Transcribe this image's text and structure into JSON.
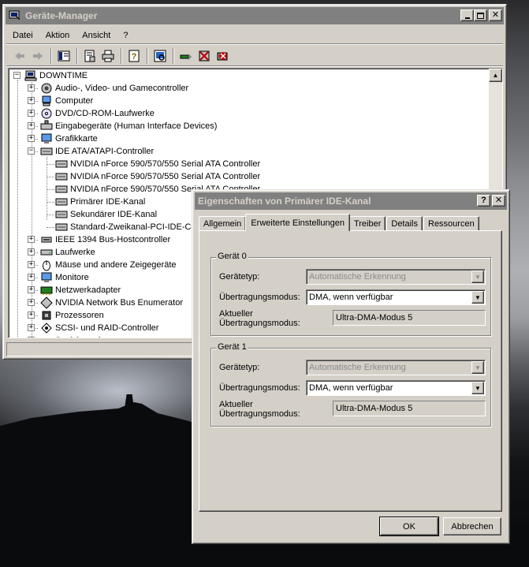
{
  "device_manager": {
    "title": "Geräte-Manager",
    "menu": [
      "Datei",
      "Aktion",
      "Ansicht",
      "?"
    ],
    "toolbar_icons": [
      "back-arrow-icon",
      "forward-arrow-icon",
      "console-tree-icon",
      "properties-icon",
      "print-icon",
      "help-icon",
      "scan-hardware-icon",
      "update-driver-icon",
      "disable-device-icon",
      "uninstall-device-icon"
    ],
    "tree": {
      "root": "DOWNTIME",
      "categories": [
        {
          "label": "Audio-, Video- und Gamecontroller",
          "icon": "speaker-icon",
          "expanded": false
        },
        {
          "label": "Computer",
          "icon": "computer-icon",
          "expanded": false
        },
        {
          "label": "DVD/CD-ROM-Laufwerke",
          "icon": "cd-drive-icon",
          "expanded": false
        },
        {
          "label": "Eingabegeräte (Human Interface Devices)",
          "icon": "hid-icon",
          "expanded": false
        },
        {
          "label": "Grafikkarte",
          "icon": "display-adapter-icon",
          "expanded": false
        },
        {
          "label": "IDE ATA/ATAPI-Controller",
          "icon": "ide-controller-icon",
          "expanded": true,
          "children": [
            "NVIDIA nForce 590/570/550 Serial ATA Controller",
            "NVIDIA nForce 590/570/550 Serial ATA Controller",
            "NVIDIA nForce 590/570/550 Serial ATA Controller",
            "Primärer IDE-Kanal",
            "Sekundärer IDE-Kanal",
            "Standard-Zweikanal-PCI-IDE-Con"
          ]
        },
        {
          "label": "IEEE 1394 Bus-Hostcontroller",
          "icon": "ieee1394-icon",
          "expanded": false
        },
        {
          "label": "Laufwerke",
          "icon": "disk-drive-icon",
          "expanded": false
        },
        {
          "label": "Mäuse und andere Zeigegeräte",
          "icon": "mouse-icon",
          "expanded": false
        },
        {
          "label": "Monitore",
          "icon": "monitor-icon",
          "expanded": false
        },
        {
          "label": "Netzwerkadapter",
          "icon": "network-adapter-icon",
          "expanded": false
        },
        {
          "label": "NVIDIA Network Bus Enumerator",
          "icon": "bus-enumerator-icon",
          "expanded": false
        },
        {
          "label": "Prozessoren",
          "icon": "processor-icon",
          "expanded": false
        },
        {
          "label": "SCSI- und RAID-Controller",
          "icon": "scsi-raid-icon",
          "expanded": false
        },
        {
          "label": "Speichervolumes",
          "icon": "storage-volume-icon",
          "expanded": false
        }
      ]
    }
  },
  "properties_dialog": {
    "title": "Eigenschaften von Primärer IDE-Kanal",
    "tabs": [
      "Allgemein",
      "Erweiterte Einstellungen",
      "Treiber",
      "Details",
      "Ressourcen"
    ],
    "selected_tab": "Erweiterte Einstellungen",
    "devices": [
      {
        "group_title": "Gerät 0",
        "device_type_label": "Gerätetyp:",
        "device_type_value": "Automatische Erkennung",
        "transfer_mode_label": "Übertragungsmodus:",
        "transfer_mode_value": "DMA, wenn verfügbar",
        "current_mode_label_1": "Aktueller",
        "current_mode_label_2": "Übertragungsmodus:",
        "current_mode_value": "Ultra-DMA-Modus 5"
      },
      {
        "group_title": "Gerät 1",
        "device_type_label": "Gerätetyp:",
        "device_type_value": "Automatische Erkennung",
        "transfer_mode_label": "Übertragungsmodus:",
        "transfer_mode_value": "DMA, wenn verfügbar",
        "current_mode_label_1": "Aktueller",
        "current_mode_label_2": "Übertragungsmodus:",
        "current_mode_value": "Ultra-DMA-Modus 5"
      }
    ],
    "ok_label": "OK",
    "cancel_label": "Abbrechen",
    "help_glyph": "?",
    "close_glyph": "✕"
  },
  "colors": {
    "window_face": "#d4d0c8",
    "inactive_titlebar": "#808080",
    "disabled_text": "#8a8a8a"
  }
}
